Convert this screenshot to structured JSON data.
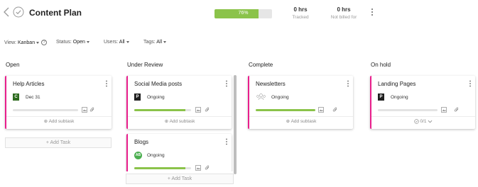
{
  "header": {
    "title": "Content Plan",
    "progress_value": 76,
    "progress_label": "76%",
    "tracked_value": "0 hrs",
    "tracked_label": "Tracked",
    "not_billed_value": "0 hrs",
    "not_billed_label": "Not billed for"
  },
  "filters": {
    "view_key": "View:",
    "view_value": "Kanban",
    "status_key": "Status:",
    "status_value": "Open",
    "users_key": "Users:",
    "users_value": "All",
    "tags_key": "Tags:",
    "tags_value": "All"
  },
  "columns": {
    "open": {
      "title": "Open",
      "add_task": "+ Add Task",
      "card": {
        "title": "Help Articles",
        "badge": "C",
        "badge_color": "#2e6b1f",
        "meta": "Dec 31",
        "progress": 0,
        "footer": "Add subtask"
      }
    },
    "review": {
      "title": "Under Review",
      "add_task": "+ Add Task",
      "card1": {
        "title": "Social Media posts",
        "badge": "P",
        "badge_color": "#1f1f1f",
        "meta": "Ongoing",
        "progress": 0.9,
        "footer": "Add subtask"
      },
      "card2": {
        "title": "Blogs",
        "badge": "AB",
        "badge_color": "#4caf50",
        "meta": "Ongoing",
        "progress": 0.9
      }
    },
    "complete": {
      "title": "Complete",
      "card": {
        "title": "Newsletters",
        "meta": "Ongoing",
        "progress": 0.9,
        "footer": "Add subtask"
      }
    },
    "hold": {
      "title": "On hold",
      "card": {
        "title": "Landing Pages",
        "badge": "P",
        "badge_color": "#1f1f1f",
        "meta": "Ongoing",
        "progress": 0,
        "footer": "0/1"
      }
    }
  },
  "colors": {
    "accent": "#8bc34a",
    "card_border": "#e91e8c"
  }
}
